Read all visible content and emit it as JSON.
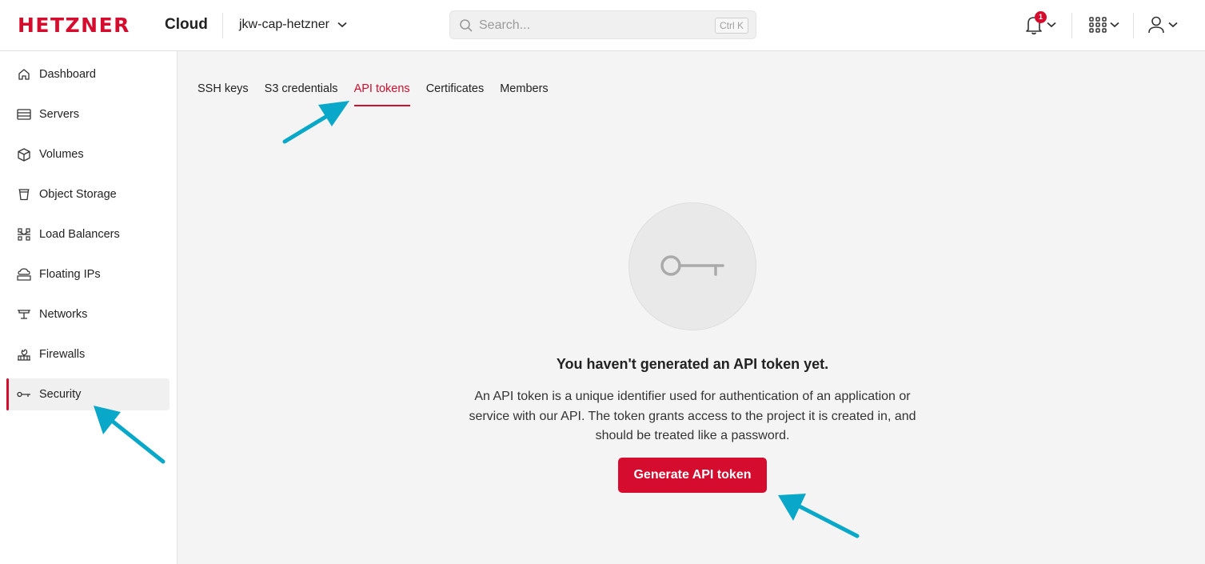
{
  "header": {
    "logo": "HETZNER",
    "product": "Cloud",
    "project": "jkw-cap-hetzner",
    "search_placeholder": "Search...",
    "search_shortcut": "Ctrl K",
    "notification_count": "1"
  },
  "sidebar": {
    "items": [
      {
        "label": "Dashboard",
        "icon": "home-icon"
      },
      {
        "label": "Servers",
        "icon": "server-icon"
      },
      {
        "label": "Volumes",
        "icon": "cube-icon"
      },
      {
        "label": "Object Storage",
        "icon": "bucket-icon"
      },
      {
        "label": "Load Balancers",
        "icon": "load-balancer-icon"
      },
      {
        "label": "Floating IPs",
        "icon": "cloud-ip-icon"
      },
      {
        "label": "Networks",
        "icon": "network-icon"
      },
      {
        "label": "Firewalls",
        "icon": "firewall-icon"
      },
      {
        "label": "Security",
        "icon": "key-icon",
        "active": true
      }
    ]
  },
  "tabs": [
    {
      "label": "SSH keys"
    },
    {
      "label": "S3 credentials"
    },
    {
      "label": "API tokens",
      "active": true
    },
    {
      "label": "Certificates"
    },
    {
      "label": "Members"
    }
  ],
  "empty_state": {
    "title": "You haven't generated an API token yet.",
    "description": "An API token is a unique identifier used for authentication of an application or service with our API. The token grants access to the project it is created in, and should be treated like a password.",
    "button": "Generate API token"
  },
  "colors": {
    "brand": "#d50c2d",
    "annotation_arrow": "#0aa8c8"
  }
}
